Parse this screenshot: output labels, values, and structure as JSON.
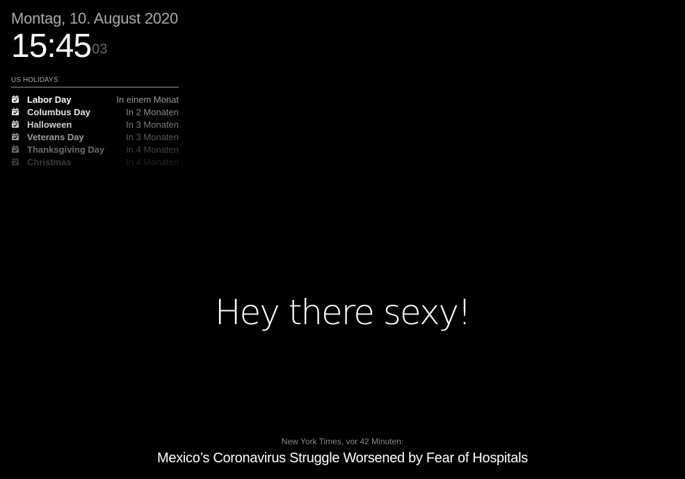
{
  "clock": {
    "date": "Montag, 10. August 2020",
    "time_hm": "15:45",
    "time_seconds": "03"
  },
  "calendar": {
    "header": "US HOLIDAYS",
    "icon": "calendar-check-icon",
    "events": [
      {
        "title": "Labor Day",
        "time": "In einem Monat",
        "opacity": 1.0
      },
      {
        "title": "Columbus Day",
        "time": "In 2 Monaten",
        "opacity": 0.9
      },
      {
        "title": "Halloween",
        "time": "In 3 Monaten",
        "opacity": 0.8
      },
      {
        "title": "Veterans Day",
        "time": "In 3 Monaten",
        "opacity": 0.6
      },
      {
        "title": "Thanksgiving Day",
        "time": "In 4 Monaten",
        "opacity": 0.42
      },
      {
        "title": "Christmas",
        "time": "In 4 Monaten",
        "opacity": 0.22
      }
    ]
  },
  "compliment": {
    "text": "Hey there sexy!"
  },
  "newsfeed": {
    "source": "New York Times, vor 42 Minuten:",
    "headline": "Mexico’s Coronavirus Struggle Worsened by Fear of Hospitals"
  }
}
